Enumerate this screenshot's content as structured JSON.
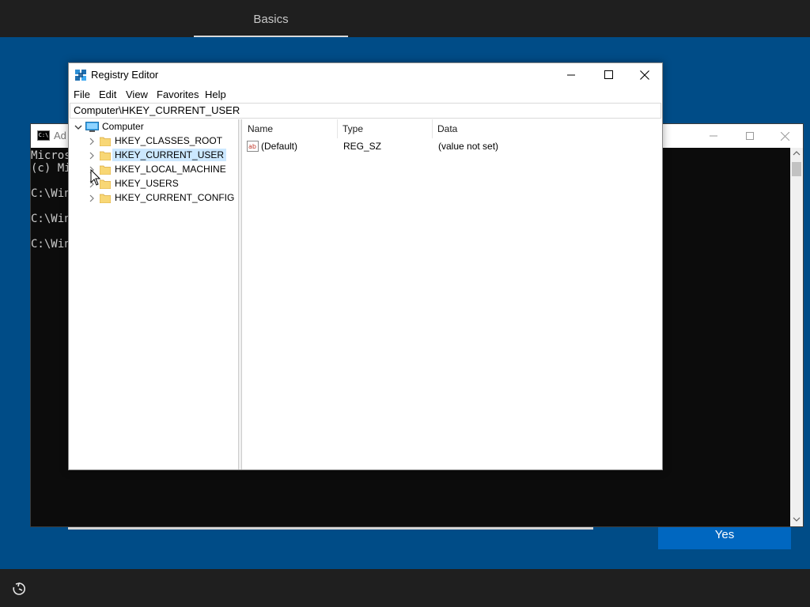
{
  "oobe": {
    "tab_label": "Basics",
    "yes_label": "Yes"
  },
  "console": {
    "title": "Ad",
    "lines": [
      "Micros",
      "(c) Mi",
      "",
      "C:\\Win",
      "",
      "C:\\Win",
      "",
      "C:\\Win"
    ]
  },
  "regedit": {
    "title": "Registry Editor",
    "menu": [
      "File",
      "Edit",
      "View",
      "Favorites",
      "Help"
    ],
    "address": "Computer\\HKEY_CURRENT_USER",
    "tree": {
      "root": "Computer",
      "children": [
        "HKEY_CLASSES_ROOT",
        "HKEY_CURRENT_USER",
        "HKEY_LOCAL_MACHINE",
        "HKEY_USERS",
        "HKEY_CURRENT_CONFIG"
      ],
      "selected": "HKEY_CURRENT_USER"
    },
    "columns": [
      "Name",
      "Type",
      "Data"
    ],
    "rows": [
      {
        "name": "(Default)",
        "type": "REG_SZ",
        "data": "(value not set)",
        "icon": "string-value-icon"
      }
    ]
  },
  "colors": {
    "desktop": "#004c87",
    "bars": "#1f1f1f",
    "accent_button": "#0067c0",
    "selection": "#cce8ff"
  }
}
